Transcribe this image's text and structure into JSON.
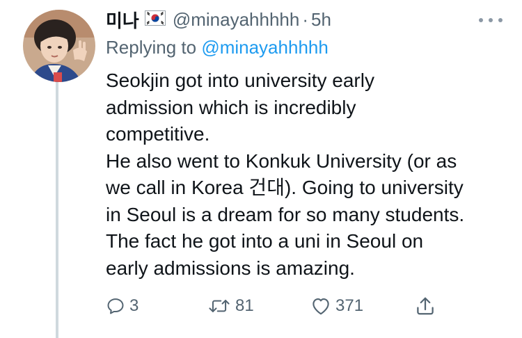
{
  "tweet": {
    "display_name": "미나",
    "flag": "🇰🇷",
    "handle": "@minayahhhhh",
    "separator": "·",
    "time": "5h",
    "replying_prefix": "Replying to",
    "replying_mention": "@minayahhhhh",
    "lines": [
      "Seokjin got into university early",
      "admission which is incredibly",
      "competitive.",
      "He also went to Konkuk University (or as",
      "we call in Korea 건대). Going to university",
      "in Seoul is a dream for so many students.",
      "The fact he got into a uni in Seoul on",
      "early admissions is amazing."
    ]
  },
  "actions": {
    "reply_count": "3",
    "retweet_count": "81",
    "like_count": "371"
  },
  "icons": {
    "more": "more-horizontal-icon",
    "reply": "reply-bubble-icon",
    "retweet": "retweet-icon",
    "like": "heart-icon",
    "share": "share-icon"
  },
  "colors": {
    "text": "#0f1419",
    "secondary": "#536471",
    "link": "#1d9bf0",
    "thread_line": "#cfd9de"
  }
}
